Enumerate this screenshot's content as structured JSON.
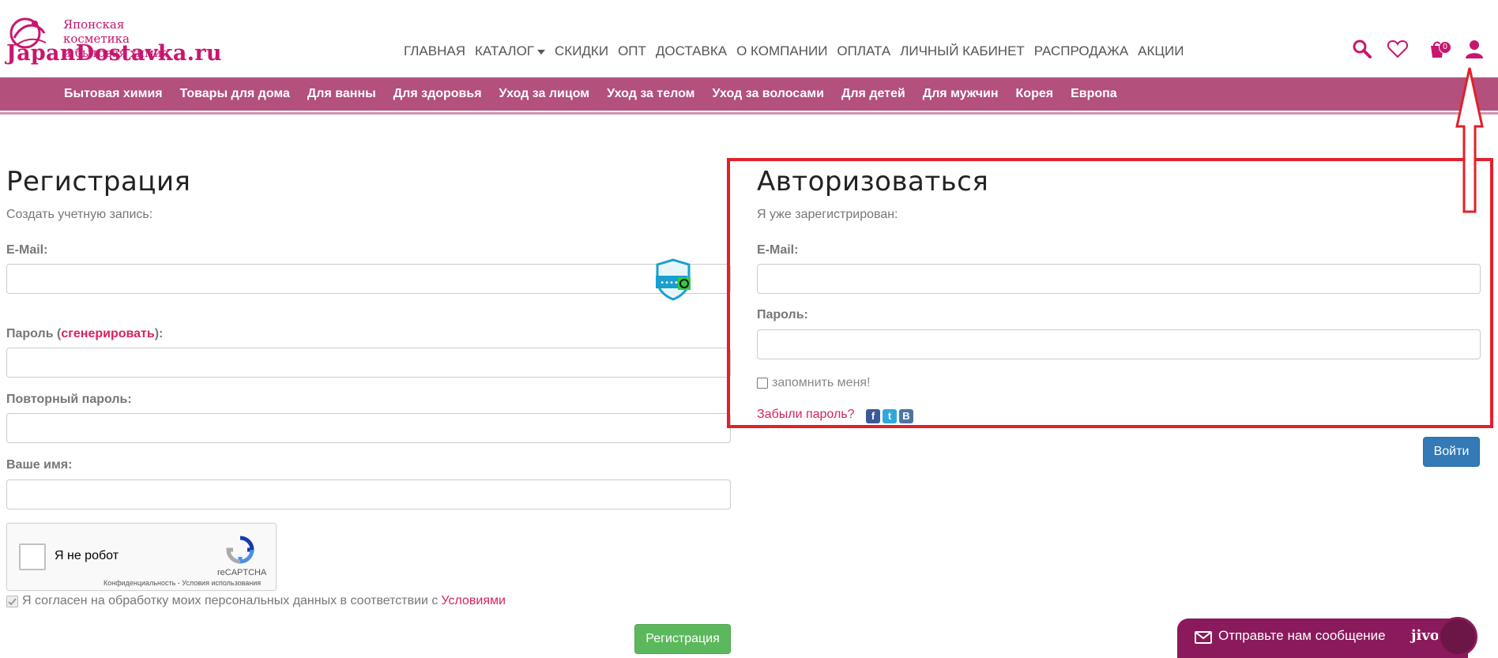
{
  "logo": {
    "tagline_1": "Японская косметика",
    "tagline_2": "и бытовая химия",
    "name": "JapanDostavka.ru"
  },
  "topnav": [
    "ГЛАВНАЯ",
    "КАТАЛОГ",
    "СКИДКИ",
    "ОПТ",
    "ДОСТАВКА",
    "О КОМПАНИИ",
    "ОПЛАТА",
    "ЛИЧНЫЙ КАБИНЕТ",
    "РАСПРОДАЖА",
    "АКЦИИ"
  ],
  "header_icons": {
    "search": "search-icon",
    "wishlist": "heart-icon",
    "cart": "cart-icon",
    "cart_count": "0",
    "account": "user-icon"
  },
  "categories": [
    "Бытовая химия",
    "Товары для дома",
    "Для ванны",
    "Для здоровья",
    "Уход за лицом",
    "Уход за телом",
    "Уход за волосами",
    "Для детей",
    "Для мужчин",
    "Корея",
    "Европа"
  ],
  "register": {
    "title": "Регистрация",
    "subtitle": "Создать учетную запись:",
    "email_label": "E-Mail:",
    "password_label": "Пароль (",
    "generate_link": "сгенерировать",
    "password_label_end": "):",
    "repeat_label": "Повторный пароль:",
    "name_label": "Ваше имя:",
    "captcha_text": "Я не робот",
    "captcha_brand": "reCAPTCHA",
    "captcha_links": "Конфиденциальность - Условия использования",
    "agree_text": "Я согласен на обработку моих персональных данных в соответствии с ",
    "agree_link": "Условиями",
    "submit": "Регистрация"
  },
  "login": {
    "title": "Авторизоваться",
    "subtitle": "Я уже зарегистрирован:",
    "email_label": "E-Mail:",
    "password_label": "Пароль:",
    "remember": "запомнить меня!",
    "forgot": "Забыли пароль?",
    "social": [
      "f",
      "t",
      "B"
    ],
    "submit": "Войти"
  },
  "chat": {
    "text": "Отправьте нам сообщение",
    "brand": "jivo"
  },
  "colors": {
    "brand": "#c8166e",
    "category_bar": "#b3507c",
    "annotation_red": "#e2202b",
    "register_button": "#5cb85c",
    "login_button": "#337ab7",
    "chat": "#8a1a5b"
  }
}
